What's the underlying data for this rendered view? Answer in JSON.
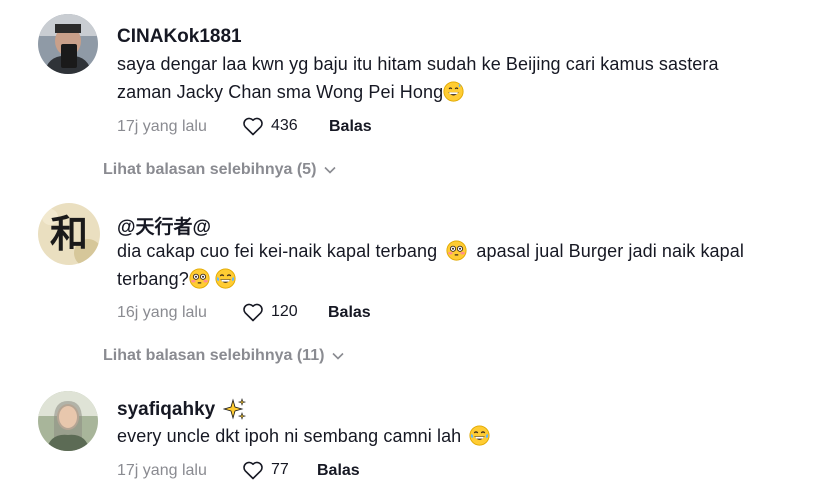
{
  "comments": [
    {
      "username": "CINAKok1881",
      "text_line1": "saya dengar laa kwn yg baju itu hitam sudah ke Beijing cari kamus sastera",
      "text_line2": "zaman Jacky Chan sma Wong Pei Hong",
      "time": "17j yang lalu",
      "likes": "436",
      "reply_label": "Balas",
      "more_replies": "Lihat balasan selebihnya (5)"
    },
    {
      "username": "@天行者@",
      "avatar_char": "和",
      "text_line1a": "dia cakap cuo fei kei-naik kapal terbang",
      "text_line1b": "apasal jual Burger jadi naik kapal",
      "text_line2": "terbang?",
      "time": "16j yang lalu",
      "likes": "120",
      "reply_label": "Balas",
      "more_replies": "Lihat balasan selebihnya (11)"
    },
    {
      "username": "syafiqahky",
      "text": "every uncle dkt ipoh ni sembang camni lah",
      "time": "17j yang lalu",
      "likes": "77",
      "reply_label": "Balas"
    }
  ]
}
